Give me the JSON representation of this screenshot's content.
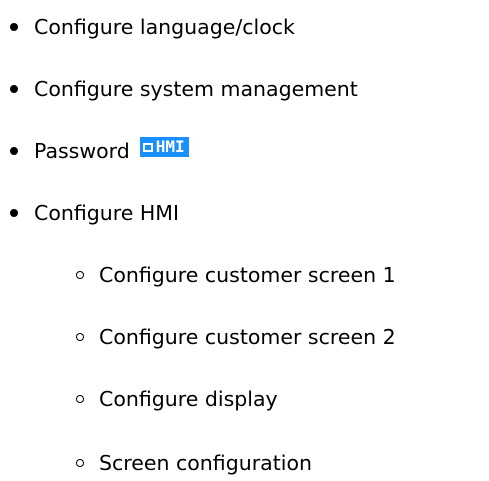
{
  "items": [
    {
      "label": "Configure language/clock"
    },
    {
      "label": "Configure system management"
    },
    {
      "label": "Password",
      "badge": "HMI"
    },
    {
      "label": "Configure HMI"
    },
    {
      "label": "Configure customer screen 1"
    },
    {
      "label": "Configure customer screen 2"
    },
    {
      "label": "Configure display"
    },
    {
      "label": "Screen configuration"
    }
  ],
  "colors": {
    "badge_background": "#1a8fff",
    "text": "#000000"
  },
  "icons": {
    "badge_icon": "hmi-logo-icon"
  }
}
